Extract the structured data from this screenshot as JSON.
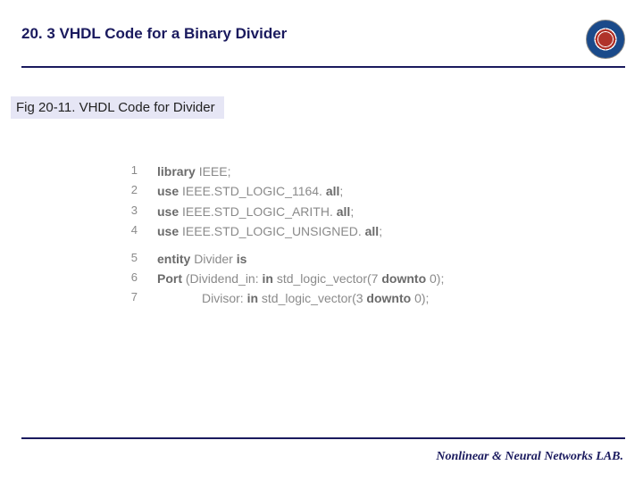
{
  "header": {
    "title": "20. 3 VHDL Code for a Binary Divider"
  },
  "subtitle": "Fig 20-11. VHDL Code for Divider",
  "code": {
    "lines": [
      {
        "n": "1",
        "parts": [
          {
            "t": "library",
            "b": true
          },
          {
            "t": " IEEE;",
            "b": false
          }
        ]
      },
      {
        "n": "2",
        "parts": [
          {
            "t": "use",
            "b": true
          },
          {
            "t": " IEEE.STD_LOGIC_1164. ",
            "b": false
          },
          {
            "t": "all",
            "b": true
          },
          {
            "t": ";",
            "b": false
          }
        ]
      },
      {
        "n": "3",
        "parts": [
          {
            "t": "use",
            "b": true
          },
          {
            "t": " IEEE.STD_LOGIC_ARITH. ",
            "b": false
          },
          {
            "t": "all",
            "b": true
          },
          {
            "t": ";",
            "b": false
          }
        ]
      },
      {
        "n": "4",
        "parts": [
          {
            "t": "use",
            "b": true
          },
          {
            "t": " IEEE.STD_LOGIC_UNSIGNED. ",
            "b": false
          },
          {
            "t": "all",
            "b": true
          },
          {
            "t": ";",
            "b": false
          }
        ]
      }
    ],
    "lines2": [
      {
        "n": "5",
        "indent": "",
        "parts": [
          {
            "t": "entity",
            "b": true
          },
          {
            "t": " Divider ",
            "b": false
          },
          {
            "t": "is",
            "b": true
          }
        ]
      },
      {
        "n": "6",
        "indent": "",
        "parts": [
          {
            "t": "Port",
            "b": true
          },
          {
            "t": " (Dividend_in: ",
            "b": false
          },
          {
            "t": "in",
            "b": true
          },
          {
            "t": " std_logic_vector(7 ",
            "b": false
          },
          {
            "t": "downto",
            "b": true
          },
          {
            "t": " 0);",
            "b": false
          }
        ]
      },
      {
        "n": "7",
        "indent": "indent2",
        "parts": [
          {
            "t": "Divisor: ",
            "b": false
          },
          {
            "t": "in",
            "b": true
          },
          {
            "t": " std_logic_vector(3 ",
            "b": false
          },
          {
            "t": "downto",
            "b": true
          },
          {
            "t": " 0);",
            "b": false
          }
        ]
      }
    ]
  },
  "footer": "Nonlinear & Neural Networks LAB."
}
